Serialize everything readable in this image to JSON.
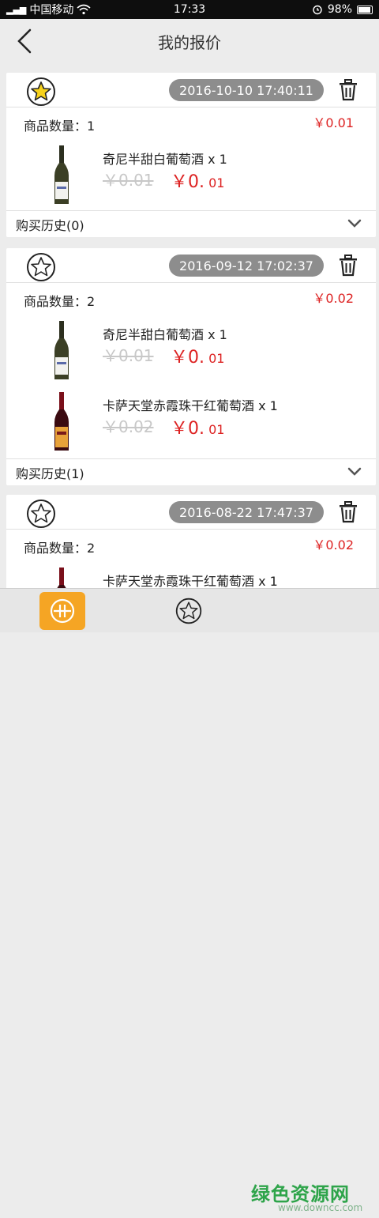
{
  "status": {
    "carrier": "中国移动",
    "time": "17:33",
    "battery": "98%"
  },
  "header": {
    "title": "我的报价"
  },
  "quotes": [
    {
      "date": "2016-10-10 17:40:11",
      "starred": true,
      "qty_label": "商品数量：1",
      "total_prefix": "￥0.",
      "total_suffix": "01",
      "products": [
        {
          "name": "奇尼半甜白葡萄酒 x 1",
          "old_price": "￥0.01",
          "new_prefix": "￥0.",
          "new_suffix": " 01",
          "wine": "white"
        }
      ],
      "history": "购买历史(0)"
    },
    {
      "date": "2016-09-12 17:02:37",
      "starred": false,
      "qty_label": "商品数量：2",
      "total_prefix": "￥0.",
      "total_suffix": "02",
      "products": [
        {
          "name": "奇尼半甜白葡萄酒 x 1",
          "old_price": "￥0.01",
          "new_prefix": "￥0.",
          "new_suffix": " 01",
          "wine": "white"
        },
        {
          "name": "卡萨天堂赤霞珠干红葡萄酒 x 1",
          "old_price": "￥0.02",
          "new_prefix": "￥0.",
          "new_suffix": " 01",
          "wine": "red"
        }
      ],
      "history": "购买历史(1)"
    },
    {
      "date": "2016-08-22 17:47:37",
      "starred": false,
      "qty_label": "商品数量：2",
      "total_prefix": "￥0.",
      "total_suffix": "02",
      "products": [
        {
          "name": "卡萨天堂赤霞珠干红葡萄酒 x 1",
          "old_price": "",
          "new_prefix": "",
          "new_suffix": "",
          "wine": "red"
        }
      ],
      "history": ""
    }
  ],
  "watermark": {
    "text": "绿色资源网",
    "url": "www.downcc.com"
  },
  "colors": {
    "accent": "#f5a524",
    "price": "#dd2222",
    "pill": "#8d8d8d"
  },
  "icons": {
    "back": "chevron-left-icon",
    "star": "star-circle-icon",
    "trash": "trash-icon",
    "expand": "chevron-down-icon",
    "tab_quote": "quote-icon",
    "tab_star": "star-outline-icon"
  }
}
